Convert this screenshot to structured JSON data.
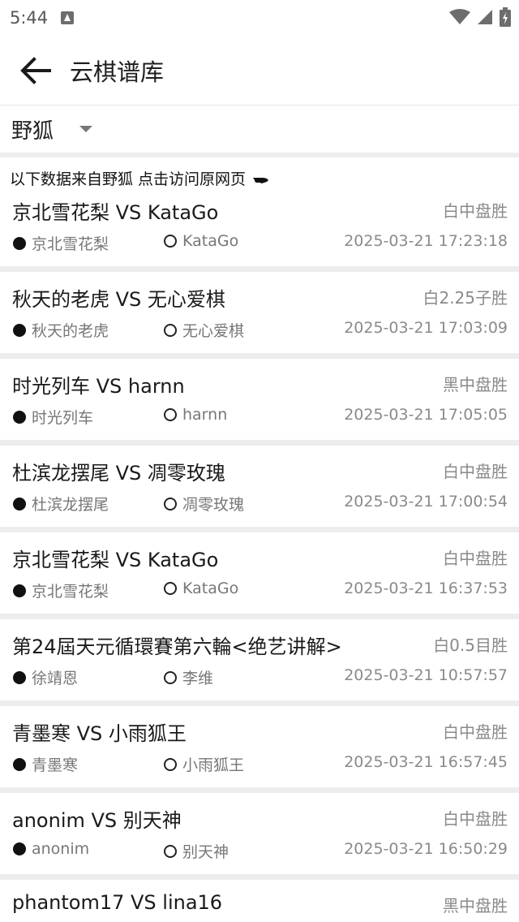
{
  "status_bar": {
    "time": "5:44"
  },
  "app_bar": {
    "title": "云棋谱库"
  },
  "selector": {
    "value": "野狐"
  },
  "info_line": "以下数据来自野狐 点击访问原网页",
  "games": [
    {
      "title": "京北雪花梨 VS KataGo",
      "result": "白中盘胜",
      "black": "京北雪花梨",
      "white": "KataGo",
      "time": "2025-03-21 17:23:18"
    },
    {
      "title": "秋天的老虎 VS 无心爱棋",
      "result": "白2.25子胜",
      "black": "秋天的老虎",
      "white": "无心爱棋",
      "time": "2025-03-21 17:03:09"
    },
    {
      "title": "时光列车 VS harnn",
      "result": "黑中盘胜",
      "black": "时光列车",
      "white": "harnn",
      "time": "2025-03-21 17:05:05"
    },
    {
      "title": "杜滨龙摆尾 VS 凋零玫瑰",
      "result": "白中盘胜",
      "black": "杜滨龙摆尾",
      "white": "凋零玫瑰",
      "time": "2025-03-21 17:00:54"
    },
    {
      "title": "京北雪花梨 VS KataGo",
      "result": "白中盘胜",
      "black": "京北雪花梨",
      "white": "KataGo",
      "time": "2025-03-21 16:37:53"
    },
    {
      "title": "第24屆天元循環賽第六輪<绝艺讲解>",
      "result": "白0.5目胜",
      "black": "徐靖恩",
      "white": "李维",
      "time": "2025-03-21 10:57:57"
    },
    {
      "title": "青墨寒 VS 小雨狐王",
      "result": "白中盘胜",
      "black": "青墨寒",
      "white": "小雨狐王",
      "time": "2025-03-21 16:57:45"
    },
    {
      "title": "anonim VS 别天神",
      "result": "白中盘胜",
      "black": "anonim",
      "white": "别天神",
      "time": "2025-03-21 16:50:29"
    },
    {
      "title": "phantom17 VS lina16",
      "result": "黑中盘胜",
      "black": "",
      "white": "",
      "time": ""
    }
  ]
}
